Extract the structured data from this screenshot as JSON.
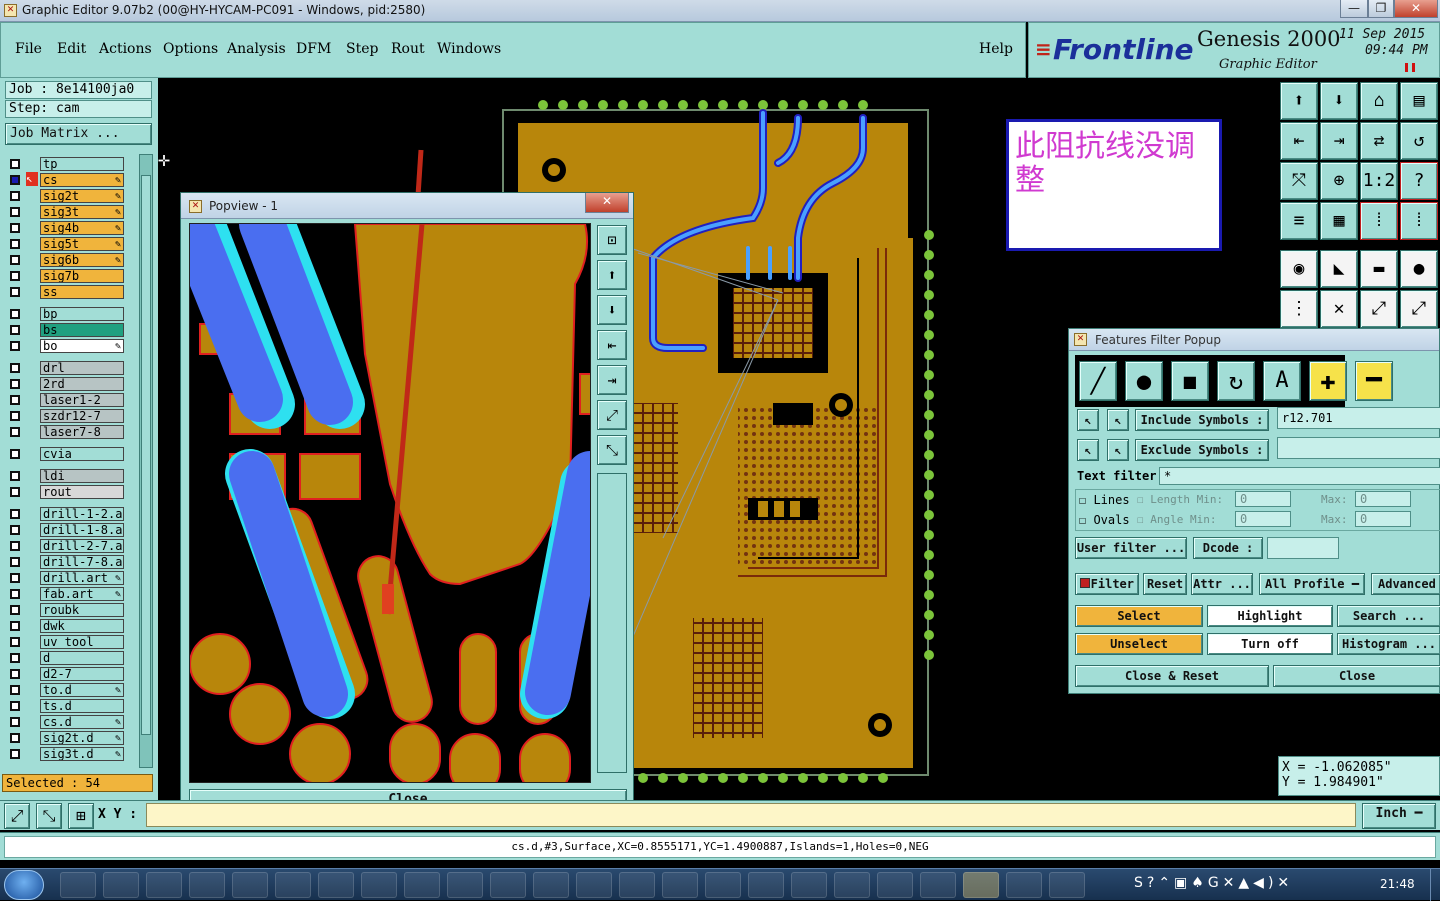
{
  "window": {
    "title": "Graphic Editor 9.07b2 (00@HY-HYCAM-PC091 - Windows, pid:2580)",
    "min_label": "—",
    "max_label": "❐",
    "close_label": "✕"
  },
  "menu": {
    "items": [
      "File",
      "Edit",
      "Actions",
      "Options",
      "Analysis",
      "DFM",
      "Step",
      "Rout",
      "Windows"
    ],
    "help": "Help"
  },
  "brand": {
    "logo": "Frontline",
    "product": "Genesis 2000",
    "subtitle": "Graphic Editor",
    "date": "11 Sep 2015",
    "time": "09:44 PM"
  },
  "job": {
    "job": "Job : 8e14100ja0",
    "step": "Step: cam",
    "matrix_button": "Job Matrix ..."
  },
  "layers": {
    "items": [
      {
        "name": "tp",
        "color": "#a2ddd6",
        "edit": false
      },
      {
        "name": "cs",
        "color": "#f0b43c",
        "edit": true,
        "active": true
      },
      {
        "name": "sig2t",
        "color": "#f0b43c",
        "edit": true
      },
      {
        "name": "sig3t",
        "color": "#f0b43c",
        "edit": true
      },
      {
        "name": "sig4b",
        "color": "#f0b43c",
        "edit": true
      },
      {
        "name": "sig5t",
        "color": "#f0b43c",
        "edit": true
      },
      {
        "name": "sig6b",
        "color": "#f0b43c",
        "edit": true
      },
      {
        "name": "sig7b",
        "color": "#f0b43c",
        "edit": false
      },
      {
        "name": "ss",
        "color": "#f0b43c",
        "edit": false
      },
      {
        "name": "bp",
        "color": "#a2ddd6",
        "edit": false
      },
      {
        "name": "bs",
        "color": "#20a080",
        "edit": false
      },
      {
        "name": "bo",
        "color": "#ffffff",
        "edit": true
      },
      {
        "name": "drl",
        "color": "#b7c4c4",
        "edit": false
      },
      {
        "name": "2rd",
        "color": "#b7c4c4",
        "edit": false
      },
      {
        "name": "laser1-2",
        "color": "#b7c4c4",
        "edit": false
      },
      {
        "name": "szdr12-7",
        "color": "#b7c4c4",
        "edit": false
      },
      {
        "name": "laser7-8",
        "color": "#b7c4c4",
        "edit": false
      },
      {
        "name": "cvia",
        "color": "#a2ddd6",
        "edit": false
      },
      {
        "name": "ldi",
        "color": "#b7c4c4",
        "edit": false
      },
      {
        "name": "rout",
        "color": "#d8d8d8",
        "edit": false
      },
      {
        "name": "drill-1-2.a",
        "color": "#a2ddd6",
        "edit": false
      },
      {
        "name": "drill-1-8.a",
        "color": "#a2ddd6",
        "edit": false
      },
      {
        "name": "drill-2-7.a",
        "color": "#a2ddd6",
        "edit": false
      },
      {
        "name": "drill-7-8.a",
        "color": "#a2ddd6",
        "edit": false
      },
      {
        "name": "drill.art",
        "color": "#a2ddd6",
        "edit": true
      },
      {
        "name": "fab.art",
        "color": "#a2ddd6",
        "edit": true
      },
      {
        "name": "roubk",
        "color": "#a2ddd6",
        "edit": false
      },
      {
        "name": "dwk",
        "color": "#a2ddd6",
        "edit": false
      },
      {
        "name": "uv_tool",
        "color": "#a2ddd6",
        "edit": false
      },
      {
        "name": "d",
        "color": "#a2ddd6",
        "edit": false
      },
      {
        "name": "d2-7",
        "color": "#a2ddd6",
        "edit": false
      },
      {
        "name": "to.d",
        "color": "#a2ddd6",
        "edit": true
      },
      {
        "name": "ts.d",
        "color": "#a2ddd6",
        "edit": false
      },
      {
        "name": "cs.d",
        "color": "#a2ddd6",
        "edit": true
      },
      {
        "name": "sig2t.d",
        "color": "#a2ddd6",
        "edit": true
      },
      {
        "name": "sig3t.d",
        "color": "#a2ddd6",
        "edit": true
      }
    ],
    "selected": "Selected : 54"
  },
  "note": {
    "text": "此阻抗线没调整"
  },
  "popview": {
    "title": "Popview - 1",
    "close_label": "Close"
  },
  "filter": {
    "title": "Features Filter Popup",
    "include_label": "Include Symbols :",
    "include_value": "r12.701",
    "exclude_label": "Exclude Symbols :",
    "exclude_value": "",
    "text_filter_label": "Text filter",
    "text_filter_value": "*",
    "lines": "Lines",
    "ovals": "Ovals",
    "length": "Length",
    "angle": "Angle",
    "min": "Min:",
    "max": "Max:",
    "zero": "0",
    "user_filter": "User filter ...",
    "dcode": "Dcode :",
    "filter_btn": "Filter",
    "reset": "Reset",
    "attr": "Attr ...",
    "all_profile": "All Profile",
    "advanced": "Advanced",
    "select": "Select",
    "highlight": "Highlight",
    "search": "Search ...",
    "unselect": "Unselect",
    "turn_off": "Turn off",
    "histogram": "Histogram ...",
    "close_reset": "Close & Reset",
    "close": "Close"
  },
  "coords": {
    "x": "X = -1.062085\"",
    "y": "Y = 1.984901\""
  },
  "bottom": {
    "xy_label": "X Y :",
    "unit": "Inch"
  },
  "status": {
    "text": "cs.d,#3,Surface,XC=0.8555171,YC=1.4900887,Islands=1,Holes=0,NEG"
  },
  "taskbar": {
    "clock": "21:48"
  }
}
